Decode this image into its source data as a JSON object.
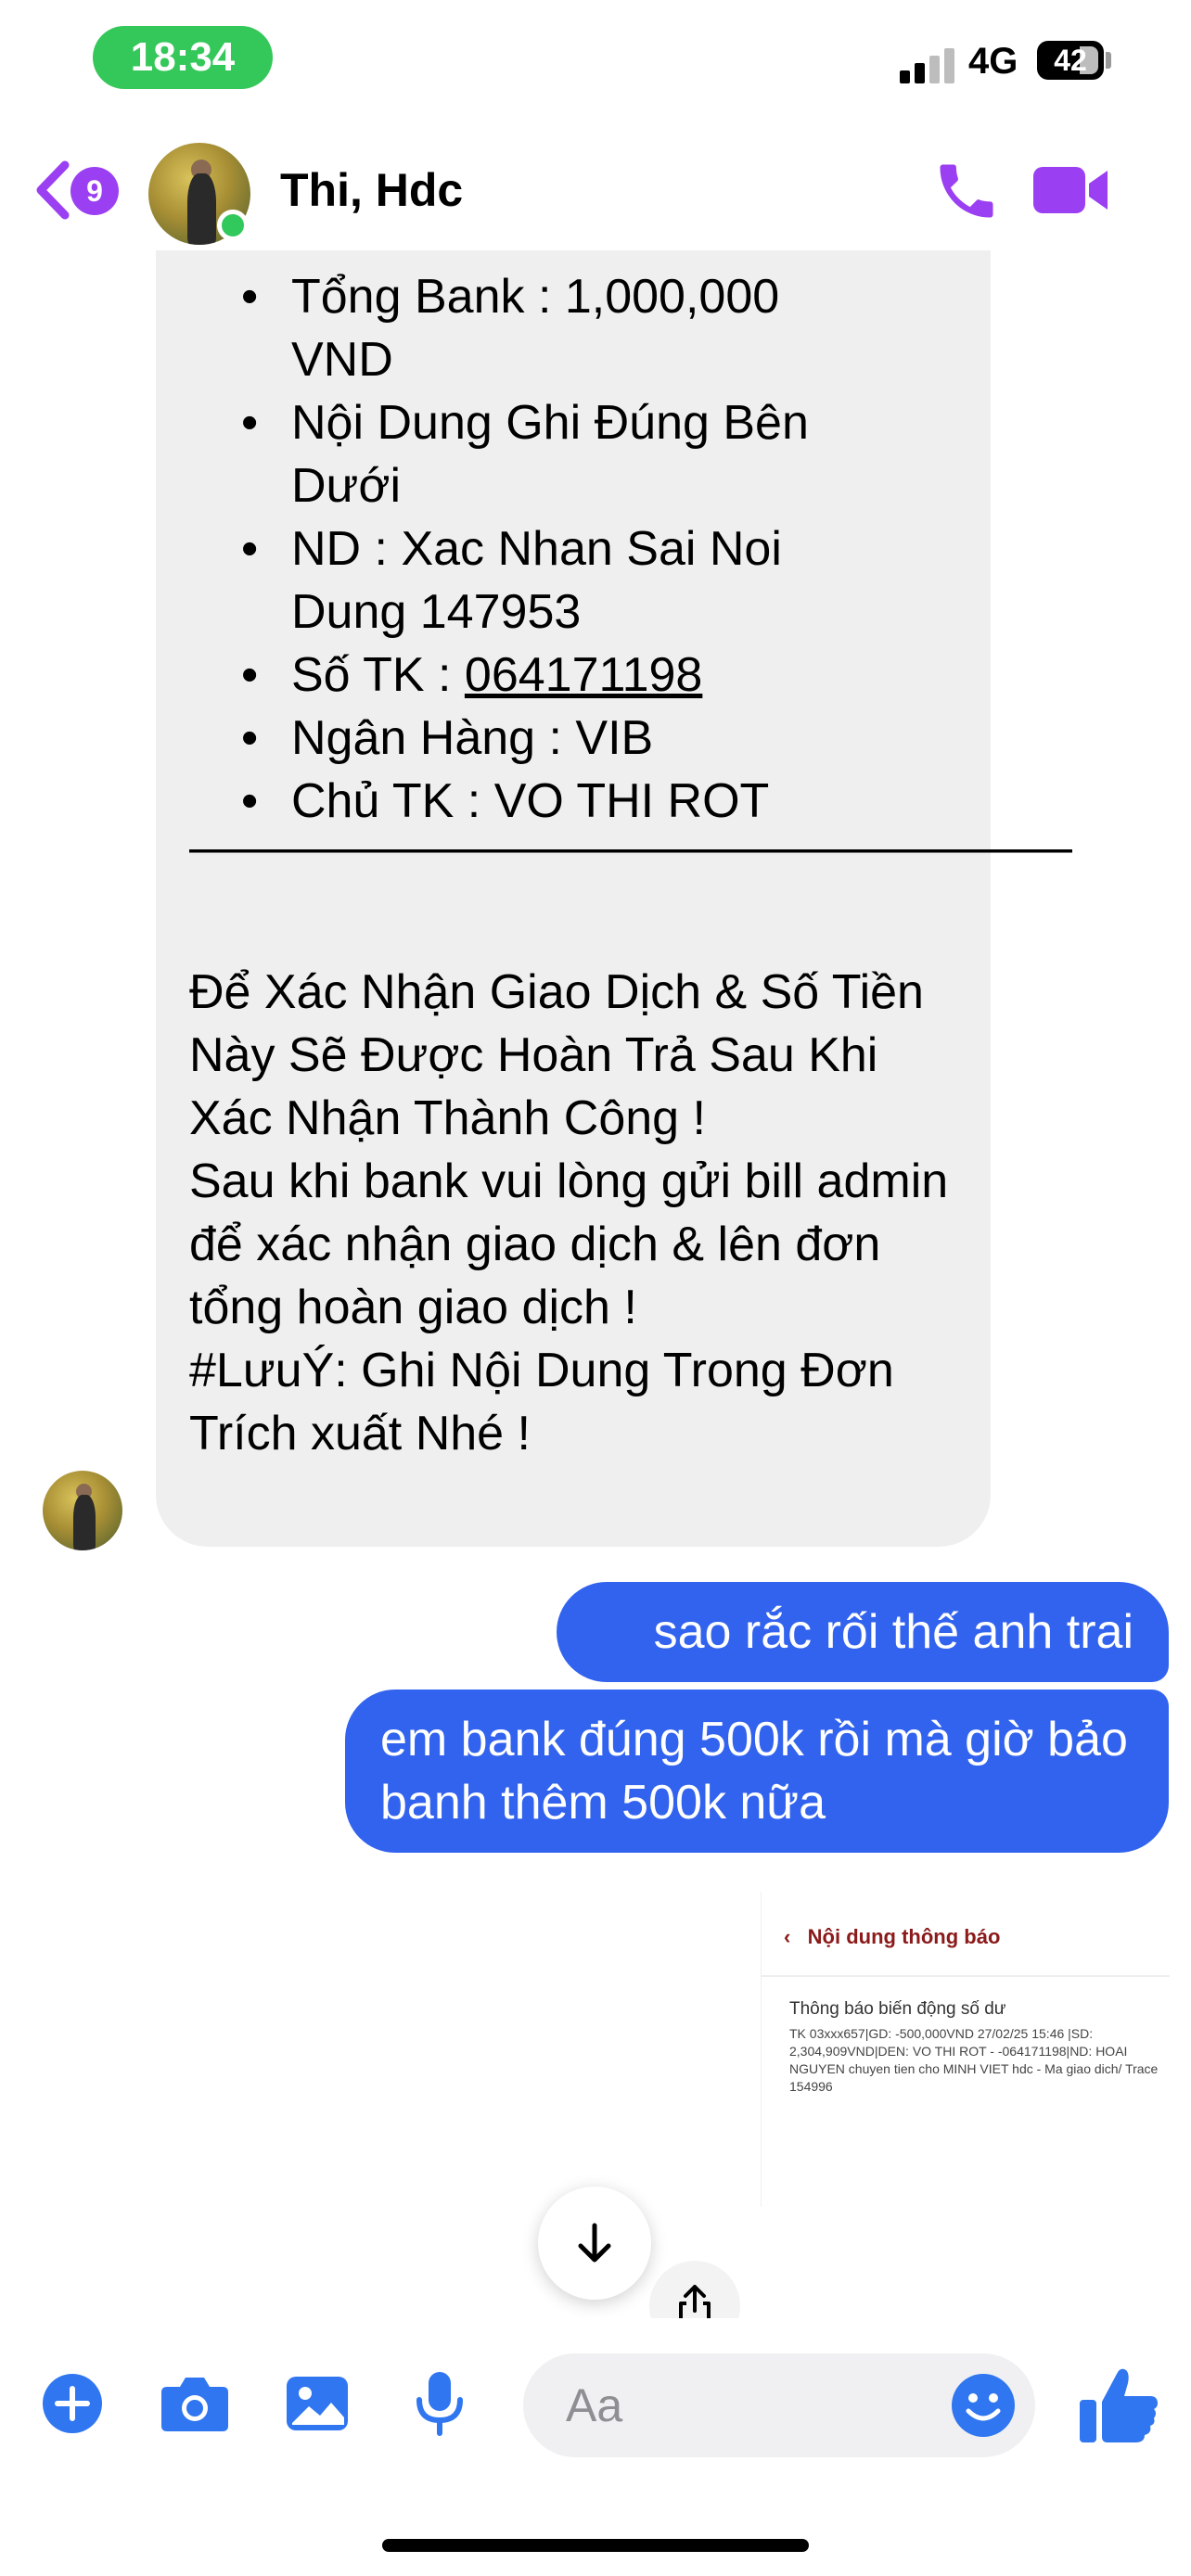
{
  "status_bar": {
    "time": "18:34",
    "network": "4G",
    "battery": "42"
  },
  "header": {
    "back_count": "9",
    "contact_name": "Thi, Hdc"
  },
  "incoming_message": {
    "bullets": [
      "Tổng Bank : 1,000,000 VND",
      "Nội Dung Ghi Đúng Bên Dưới",
      "ND : Xac Nhan Sai Noi Dung 147953"
    ],
    "account_label": "Số TK : ",
    "account_number": "064171198",
    "bank": "Ngân Hàng : VIB",
    "owner": "Chủ TK : VO THI ROT",
    "divider": "———————————————————",
    "body": "Để Xác Nhận Giao Dịch & Số Tiền Này Sẽ Được Hoàn Trả Sau Khi Xác Nhận Thành Công !\nSau khi bank vui lòng gửi bill admin để xác nhận giao dịch & lên đơn tổng hoàn giao dịch !\n#LưuÝ: Ghi Nội Dung Trong Đơn Trích xuất Nhé !"
  },
  "outgoing_messages": [
    "sao rắc rối thế anh trai",
    "em bank đúng 500k rồi mà giờ bảo banh thêm 500k nữa"
  ],
  "attachment": {
    "nav_title": "Nội dung thông báo",
    "title": "Thông báo biến động số dư",
    "detail": "TK 03xxx657|GD: -500,000VND 27/02/25 15:46 |SD: 2,304,909VND|DEN: VO THI ROT - -064171198|ND: HOAI NGUYEN chuyen tien cho MINH VIET hdc - Ma giao dich/ Trace 154996"
  },
  "composer": {
    "placeholder": "Aa"
  },
  "colors": {
    "accent": "#9b3ff2",
    "outgoing_bubble": "#3263ef",
    "incoming_bubble": "#efeff0",
    "time_pill": "#34c759",
    "tool_blue": "#2f76f0"
  }
}
